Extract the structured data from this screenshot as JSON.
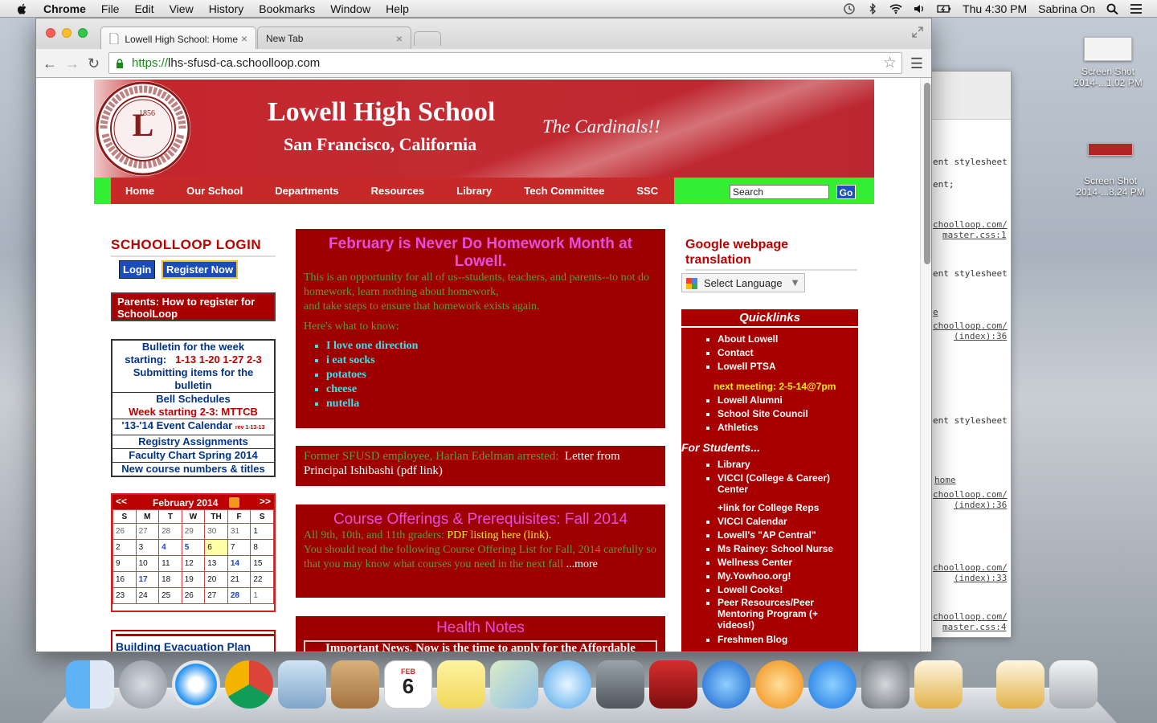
{
  "menubar": {
    "app": "Chrome",
    "items": [
      "File",
      "Edit",
      "View",
      "History",
      "Bookmarks",
      "Window",
      "Help"
    ],
    "clock": "Thu 4:30 PM",
    "user": "Sabrina On"
  },
  "desktop": {
    "icon1": {
      "label1": "Screen Shot",
      "label2": "2014-...1.02 PM"
    },
    "icon2": {
      "label1": "Screen Shot",
      "label2": "2014-...8.24 PM"
    }
  },
  "devtools": {
    "lines": [
      "ent stylesheet",
      "ent;",
      "choolloop.com/",
      "master.css:1",
      "ent stylesheet",
      "e",
      "choolloop.com/",
      "(index):36",
      "ent stylesheet",
      "home",
      "choolloop.com/",
      "(index):36",
      "choolloop.com/",
      "(index):33",
      "choolloop.com/",
      "master.css:4"
    ]
  },
  "browser": {
    "tabs": [
      {
        "title": "Lowell High School: Home"
      },
      {
        "title": "New Tab"
      }
    ],
    "url_scheme": "https://",
    "url_host": "lhs-sfusd-ca.schoolloop.com"
  },
  "banner": {
    "title": "Lowell High School",
    "subtitle": "San Francisco, California",
    "tagline": "The Cardinals!!",
    "seal_year": "1856"
  },
  "nav": {
    "items": [
      "Home",
      "Our School",
      "Departments",
      "Resources",
      "Library",
      "Tech Committee",
      "SSC"
    ],
    "search_value": "Search",
    "go_label": "Go"
  },
  "left": {
    "login_heading": "SCHOOLLOOP LOGIN",
    "login_btn": "Login",
    "register_btn": "Register Now",
    "parents_link": "Parents: How to register for SchoolLoop",
    "bulletin_line1": "Bulletin for the week",
    "bulletin_line2a": "starting:",
    "bulletin_line2b": "1-13 1-20 1-27  2-3",
    "bulletin_line3": "Submitting items for the bulletin",
    "bell": "Bell Schedules",
    "bell_week": "Week starting 2-3: MTTCB",
    "event_cal": "'13-'14 Event Calendar",
    "event_rev": "rev 1-13-13",
    "registry": "Registry Assignments",
    "faculty": "Faculty Chart Spring 2014",
    "course_nums": "New course numbers & titles",
    "evacuation": "Building Evacuation Plan"
  },
  "calendar": {
    "prev": "<<",
    "next": ">>",
    "month": "February 2014",
    "days": [
      "S",
      "M",
      "T",
      "W",
      "TH",
      "F",
      "S"
    ],
    "weeks": [
      [
        "26",
        "27",
        "28",
        "29",
        "30",
        "31",
        "1"
      ],
      [
        "2",
        "3",
        "4",
        "5",
        "6",
        "7",
        "8"
      ],
      [
        "9",
        "10",
        "11",
        "12",
        "13",
        "14",
        "15"
      ],
      [
        "16",
        "17",
        "18",
        "19",
        "20",
        "21",
        "22"
      ],
      [
        "23",
        "24",
        "25",
        "26",
        "27",
        "28",
        "1"
      ]
    ]
  },
  "center": {
    "box1_heading": "February is Never Do Homework Month at Lowell.",
    "box1_p1": "This is an opportunity for all of us--students, teachers, and parents--to not do homework, learn nothing about homework,",
    "box1_p2": "and take steps to ensure that homework exists again.",
    "box1_p3": "Here's what to know:",
    "box1_list": [
      "I love one direction",
      "i eat socks",
      "potatoes",
      "cheese",
      "nutella"
    ],
    "box2_text": "Former SFUSD employee, Harlan Edelman arrested:",
    "box2_link": "Letter from Principal Ishibashi (pdf link)",
    "box3_heading": "Course Offerings & Prerequisites: Fall 2014",
    "box3_p1": "All 9th, 10th, and 11th graders:",
    "box3_link": "PDF listing here (link).",
    "box3_p2": "You should read the following Course Offering List for Fall, 2014 carefully so that you may know what courses you need in the next fall",
    "box3_more": "...more",
    "box4_heading": "Health Notes",
    "box4_news": "Important News. Now is the time to apply for the Affordable"
  },
  "right": {
    "translate_heading": "Google webpage translation",
    "select_language": "Select Language",
    "quick_heading": "Quicklinks",
    "quick1": [
      "About Lowell",
      "Contact",
      "Lowell PTSA"
    ],
    "meeting": "next meeting: 2-5-14@7pm",
    "quick2": [
      "Lowell Alumni",
      "School Site Council",
      "Athletics"
    ],
    "students_heading": "For Students...",
    "quick3": [
      "Library",
      "VICCI (College & Career) Center"
    ],
    "quick4": [
      "+link for College Reps",
      "VICCI Calendar",
      "Lowell's \"AP Central\"",
      "Ms Rainey: School Nurse",
      "Wellness Center",
      "My.Yowhoo.org!",
      "Lowell Cooks!",
      "Peer Resources/Peer Mentoring Program (+ videos!)",
      "Freshmen Blog"
    ]
  },
  "dock": {
    "apps": [
      "finder",
      "launchpad",
      "safari",
      "chrome",
      "mail",
      "contacts",
      "calendar",
      "stickies",
      "maps",
      "messages",
      "facetime",
      "photo-booth",
      "itunes",
      "ibooks",
      "app-store",
      "system-preferences",
      "github",
      "github-2",
      "trash"
    ],
    "calendar_day": "6",
    "calendar_month": "FEB"
  }
}
